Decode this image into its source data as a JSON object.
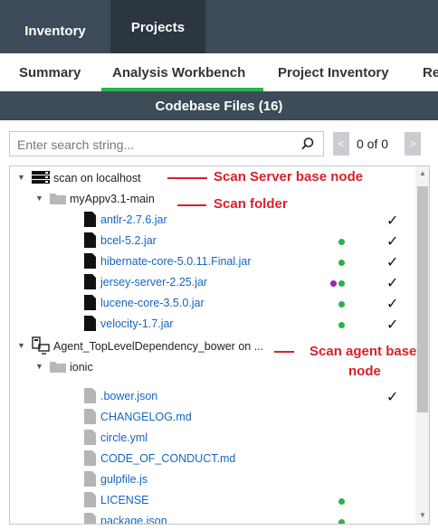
{
  "topnav": {
    "tabs": [
      {
        "label": "Inventory"
      },
      {
        "label": "Projects"
      }
    ]
  },
  "subnav": {
    "tabs": [
      {
        "label": "Summary"
      },
      {
        "label": "Analysis Workbench"
      },
      {
        "label": "Project Inventory"
      },
      {
        "label": "Re"
      }
    ]
  },
  "files_header": "Codebase Files (16)",
  "search": {
    "placeholder": "Enter search string...",
    "page_count": "0 of 0",
    "prev_label": "<",
    "next_label": ">"
  },
  "tree": {
    "nodes": [
      {
        "label": "scan on localhost",
        "icon": "server-icon"
      },
      {
        "label": "myAppv3.1-main",
        "icon": "folder-icon"
      },
      {
        "label": "antlr-2.7.6.jar",
        "check": true
      },
      {
        "label": "bcel-5.2.jar",
        "status": [
          "green"
        ],
        "check": true
      },
      {
        "label": "hibernate-core-5.0.11.Final.jar",
        "status": [
          "green"
        ],
        "check": true
      },
      {
        "label": "jersey-server-2.25.jar",
        "status": [
          "purple",
          "green"
        ],
        "check": true
      },
      {
        "label": "lucene-core-3.5.0.jar",
        "status": [
          "green"
        ],
        "check": true
      },
      {
        "label": "velocity-1.7.jar",
        "status": [
          "green"
        ],
        "check": true
      },
      {
        "label": "Agent_TopLevelDependency_bower on ...",
        "icon": "agent-icon"
      },
      {
        "label": "ionic",
        "icon": "folder-icon"
      },
      {
        "label": ".bower.json",
        "check": true
      },
      {
        "label": "CHANGELOG.md"
      },
      {
        "label": "circle.yml"
      },
      {
        "label": "CODE_OF_CONDUCT.md"
      },
      {
        "label": "gulpfile.js"
      },
      {
        "label": "LICENSE",
        "status": [
          "green"
        ]
      },
      {
        "label": "package.json",
        "status": [
          "green"
        ]
      }
    ]
  },
  "annotations": {
    "server": "Scan Server base node",
    "folder": "Scan folder",
    "agent_line1": "Scan agent base",
    "agent_line2": "node"
  },
  "colors": {
    "nav_bg": "#3d4a57",
    "active_tab": "#2c3641",
    "accent_green": "#27b24a",
    "link": "#1565c0",
    "annotation": "#d8202a",
    "purple": "#a020c0"
  }
}
